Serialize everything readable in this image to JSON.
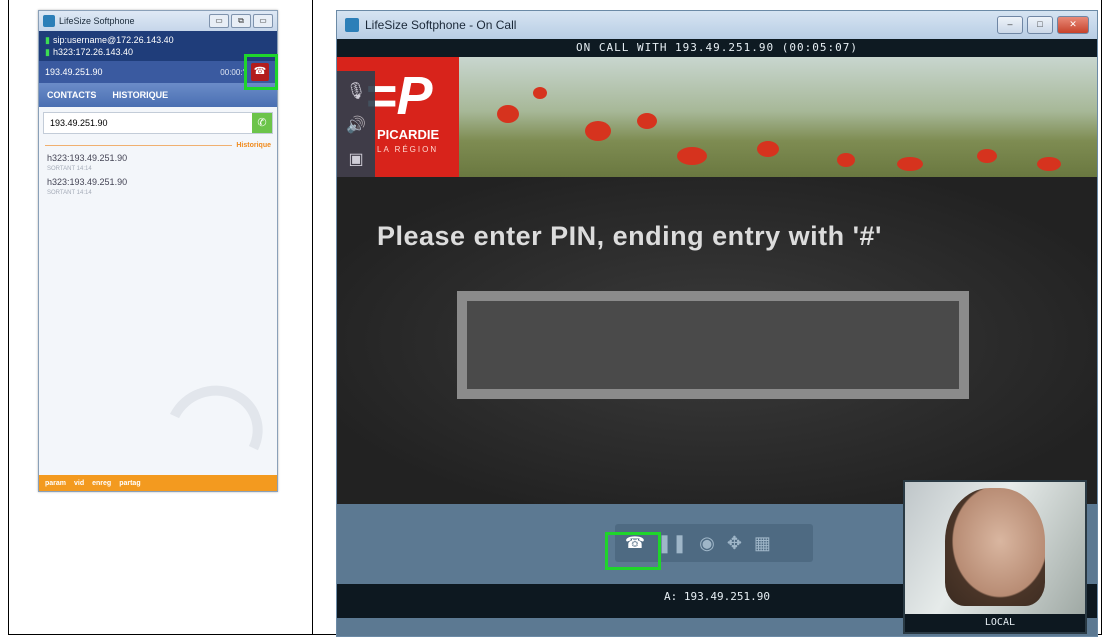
{
  "small_softphone": {
    "title": "LifeSize Softphone",
    "window_buttons": [
      "▭",
      "⧉",
      "▭"
    ],
    "accounts": [
      "sip:username@172.26.143.40",
      "h323:172.26.143.40"
    ],
    "active_call": {
      "address": "193.49.251.90",
      "timer": "00:00:?"
    },
    "tabs": [
      "CONTACTS",
      "HISTORIQUE"
    ],
    "dial_value": "193.49.251.90",
    "history_label": "Historique",
    "history": [
      {
        "address": "h323:193.49.251.90",
        "detail": "SORTANT 14:14"
      },
      {
        "address": "h323:193.49.251.90",
        "detail": "SORTANT 14:14"
      }
    ],
    "bottom_bar": [
      "param",
      "vid",
      "enreg",
      "partag"
    ]
  },
  "main_window": {
    "title": "LifeSize Softphone - On Call",
    "call_header": "ON CALL WITH 193.49.251.90 (00:05:07)",
    "banner_logo": {
      "name": "PICARDIE",
      "sub": "LA RÉGION"
    },
    "prompt": "Please enter PIN, ending entry with '#'",
    "remote_label": "A: 193.49.251.90",
    "local_label": "LOCAL"
  },
  "colors": {
    "highlight": "#1fd52b",
    "hangup_red": "#b31d1d",
    "brand_orange": "#f39a1f"
  }
}
